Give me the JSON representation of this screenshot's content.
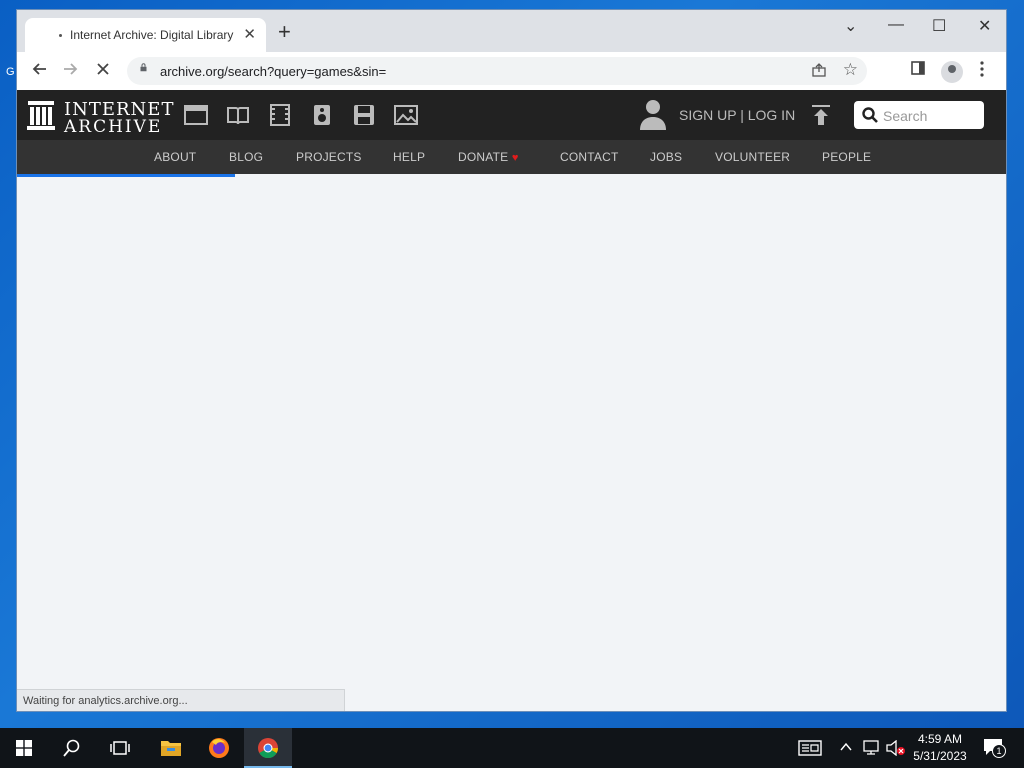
{
  "desktop": {
    "peek_letter": "G"
  },
  "browser": {
    "tab_title": "Internet Archive: Digital Library of Free & Borrowable Books, Movies, Music & Wayback Machine",
    "tab_close": "✕",
    "new_tab": "+",
    "url": "archive.org/search?query=games&sin=",
    "window_controls": {
      "tab_search": "⌄",
      "minimize": "—",
      "maximize": "☐",
      "close": "✕"
    },
    "status_text": "Waiting for analytics.archive.org..."
  },
  "ia": {
    "logo_line1": "INTERNET",
    "logo_line2": "ARCHIVE",
    "media_icons": [
      "web-icon",
      "texts-icon",
      "video-icon",
      "audio-icon",
      "software-icon",
      "images-icon"
    ],
    "signin_text": "SIGN UP | LOG IN",
    "search_placeholder": "Search",
    "nav": [
      "ABOUT",
      "BLOG",
      "PROJECTS",
      "HELP",
      "DONATE",
      "CONTACT",
      "JOBS",
      "VOLUNTEER",
      "PEOPLE"
    ],
    "donate_heart": "♥"
  },
  "taskbar": {
    "time": "4:59 AM",
    "date": "5/31/2023",
    "notification_count": "1"
  },
  "colors": {
    "ia_header": "#222222",
    "ia_nav": "#333333",
    "progress": "#1a73e8",
    "heart": "#e31c1c"
  }
}
